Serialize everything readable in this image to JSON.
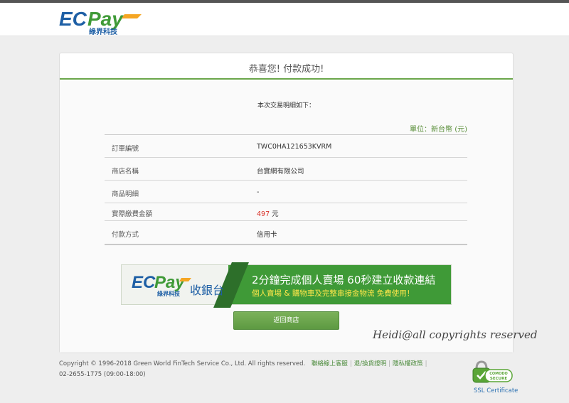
{
  "brand": {
    "logo_text": "ECPay",
    "logo_sub": "綠界科技"
  },
  "page": {
    "title": "恭喜您! 付款成功!",
    "intro": "本次交易明細如下：",
    "unit": "單位：新台幣 (元)"
  },
  "details": [
    {
      "label": "訂單編號",
      "value": "TWC0HA121653KVRM"
    },
    {
      "label": "商店名稱",
      "value": "台實網有限公司"
    },
    {
      "label": "商品明細",
      "value": "-"
    },
    {
      "label": "實際繳費金額",
      "amount": "497",
      "currency": "元"
    },
    {
      "label": "付款方式",
      "value": "信用卡"
    }
  ],
  "banner": {
    "logo_text": "ECPay",
    "logo_sub": "綠界科技",
    "product": "收銀台",
    "line1": "2分鐘完成個人賣場  60秒建立收款連結",
    "line2": "個人賣場 & 購物車及完整串接金物流  免費使用！"
  },
  "actions": {
    "back_label": "返回商店"
  },
  "watermark": "Heidi@all copyrights reserved",
  "footer": {
    "copyright": "Copyright © 1996-2018 Green World FinTech Service Co., Ltd. All rights reserved.",
    "links": [
      "聯絡線上客服",
      "退/換貨證明",
      "隱私權政策"
    ],
    "phone": "02-2655-1775 (09:00-18:00)"
  },
  "ssl": {
    "badge_top": "COMODO",
    "badge_bottom": "SECURE",
    "label": "SSL Certificate"
  },
  "colors": {
    "brand_green": "#3f9a37",
    "accent_orange": "#f5a623",
    "price_red": "#d9342b",
    "link_blue": "#2f73b3"
  },
  "icons": {
    "ssl": "padlock-icon"
  }
}
